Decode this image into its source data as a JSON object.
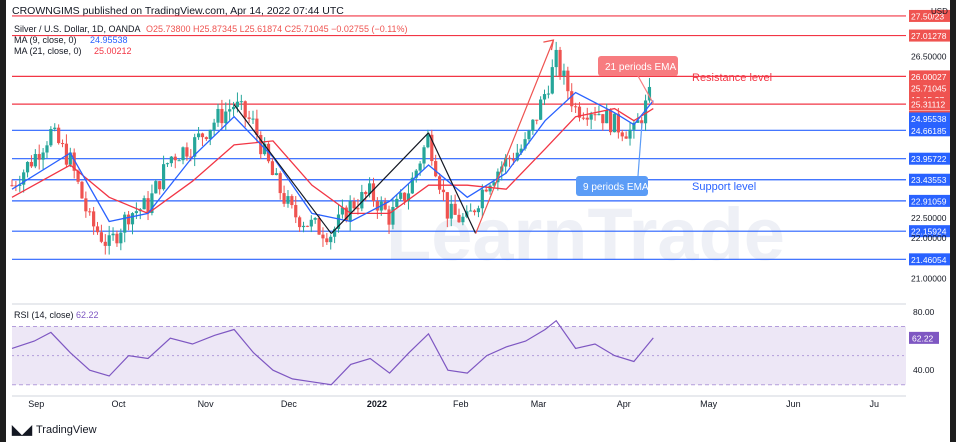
{
  "header": {
    "publisher": "CROWNGIMS published on TradingView.com, Apr 14, 2022 07:44 UTC"
  },
  "legend": {
    "symbol_line": "Silver / U.S. Dollar, 1D, OANDA",
    "ohlc": "O25.73800  H25.87345  L25.61874  C25.71045  −0.02755 (−0.11%)",
    "ma9": "MA (9, close, 0)",
    "ma9_value": "24.95538",
    "ma21": "MA (21, close, 0)",
    "ma21_value": "25.00212",
    "rsi": "RSI (14, close)",
    "rsi_value": "62.22"
  },
  "annotations": {
    "ema21": "21 periods EMA",
    "ema9": "9 periods EMA",
    "resistance": "Resistance level",
    "support": "Support level"
  },
  "footer": {
    "brand": "TradingView"
  },
  "colors": {
    "bull": "#26a69a",
    "bear": "#ef5350",
    "ma9": "#2962ff",
    "ma21": "#f23645",
    "resistance_line": "#f23645",
    "support_line": "#2962ff",
    "rsi": "#7e57c2",
    "ema21_label_bg": "#f77c80",
    "ema9_label_bg": "#5b9cf6",
    "current_price": "#e53935"
  },
  "chart_data": [
    {
      "type": "candlestick",
      "price_ylim": [
        20.6,
        27.3
      ],
      "y_ticks": [
        21.0,
        22.0,
        22.5,
        26.5
      ],
      "x_ticks": [
        "Sep",
        "Oct",
        "Nov",
        "Dec",
        "2022",
        "Feb",
        "Mar",
        "Apr",
        "May",
        "Jun",
        "Ju"
      ],
      "price_labels": [
        {
          "value": 27.5,
          "text": "27.50/23"
        },
        {
          "value": 27.01278,
          "text": "27.01278"
        },
        {
          "value": 26.5,
          "text": "26.50000"
        },
        {
          "value": 26.00027,
          "text": "26.00027"
        },
        {
          "value": 25.71045,
          "text": "25.71045"
        },
        {
          "value": 25.43,
          "text": "13:15:37"
        },
        {
          "value": 25.31112,
          "text": "25.31112"
        },
        {
          "value": 25.00212,
          "text": "25.00212"
        },
        {
          "value": 24.95538,
          "text": "24.95538"
        },
        {
          "value": 24.66185,
          "text": "24.66185"
        },
        {
          "value": 23.95722,
          "text": "23.95722"
        },
        {
          "value": 23.43553,
          "text": "23.43553"
        },
        {
          "value": 22.91059,
          "text": "22.91059"
        },
        {
          "value": 22.5,
          "text": "22.50000"
        },
        {
          "value": 22.15924,
          "text": "22.15924"
        },
        {
          "value": 22.0,
          "text": "22.00000"
        },
        {
          "value": 21.46054,
          "text": "21.46054"
        },
        {
          "value": 21.0,
          "text": "21.00000"
        }
      ],
      "resistance_levels": [
        27.5,
        27.01278,
        26.00027,
        25.31112
      ],
      "support_levels": [
        24.66185,
        23.95722,
        23.43553,
        22.91059,
        22.15924,
        21.46054
      ],
      "close_path": [
        [
          "Aug 24",
          23.3
        ],
        [
          "Sep 1",
          24.0
        ],
        [
          "Sep 7",
          24.6
        ],
        [
          "Sep 14",
          23.9
        ],
        [
          "Sep 21",
          22.4
        ],
        [
          "Sep 28",
          21.8
        ],
        [
          "Oct 5",
          22.6
        ],
        [
          "Oct 12",
          22.8
        ],
        [
          "Oct 20",
          24.0
        ],
        [
          "Oct 28",
          24.3
        ],
        [
          "Nov 5",
          24.9
        ],
        [
          "Nov 12",
          25.3
        ],
        [
          "Nov 19",
          24.8
        ],
        [
          "Nov 26",
          23.5
        ],
        [
          "Dec 3",
          22.6
        ],
        [
          "Dec 10",
          22.3
        ],
        [
          "Dec 17",
          22.1
        ],
        [
          "Dec 24",
          22.8
        ],
        [
          "Dec 31",
          23.1
        ],
        [
          "Jan 7",
          22.5
        ],
        [
          "Jan 14",
          23.2
        ],
        [
          "Jan 21",
          24.5
        ],
        [
          "Jan 28",
          22.6
        ],
        [
          "Feb 4",
          22.4
        ],
        [
          "Feb 11",
          23.4
        ],
        [
          "Feb 18",
          23.9
        ],
        [
          "Feb 25",
          24.3
        ],
        [
          "Mar 4",
          25.6
        ],
        [
          "Mar 8",
          26.4
        ],
        [
          "Mar 15",
          25.2
        ],
        [
          "Mar 22",
          25.2
        ],
        [
          "Mar 29",
          24.8
        ],
        [
          "Apr 5",
          24.6
        ],
        [
          "Apr 12",
          25.7
        ]
      ],
      "ma9_path": [
        [
          "Aug 24",
          23.2
        ],
        [
          "Sep 14",
          24.1
        ],
        [
          "Sep 28",
          22.4
        ],
        [
          "Oct 12",
          22.6
        ],
        [
          "Oct 28",
          24.0
        ],
        [
          "Nov 12",
          25.0
        ],
        [
          "Nov 26",
          24.0
        ],
        [
          "Dec 10",
          22.6
        ],
        [
          "Dec 24",
          22.4
        ],
        [
          "Jan 7",
          22.9
        ],
        [
          "Jan 21",
          23.8
        ],
        [
          "Feb 4",
          23.0
        ],
        [
          "Feb 18",
          23.6
        ],
        [
          "Mar 4",
          24.9
        ],
        [
          "Mar 15",
          25.6
        ],
        [
          "Mar 29",
          25.1
        ],
        [
          "Apr 5",
          24.8
        ],
        [
          "Apr 12",
          25.4
        ]
      ],
      "ma21_path": [
        [
          "Aug 24",
          23.0
        ],
        [
          "Sep 14",
          23.8
        ],
        [
          "Sep 28",
          23.0
        ],
        [
          "Oct 12",
          22.6
        ],
        [
          "Oct 28",
          23.4
        ],
        [
          "Nov 12",
          24.3
        ],
        [
          "Nov 26",
          24.4
        ],
        [
          "Dec 10",
          23.3
        ],
        [
          "Dec 24",
          22.6
        ],
        [
          "Jan 7",
          22.6
        ],
        [
          "Jan 21",
          23.3
        ],
        [
          "Feb 4",
          23.3
        ],
        [
          "Feb 18",
          23.2
        ],
        [
          "Mar 4",
          24.2
        ],
        [
          "Mar 15",
          25.0
        ],
        [
          "Mar 29",
          25.2
        ],
        [
          "Apr 5",
          24.9
        ],
        [
          "Apr 12",
          25.2
        ]
      ],
      "drawn_trendlines": [
        [
          [
            "Nov 12",
            25.3
          ],
          [
            "Dec 17",
            22.1
          ]
        ],
        [
          [
            "Dec 17",
            22.1
          ],
          [
            "Jan 21",
            24.6
          ]
        ],
        [
          [
            "Jan 21",
            24.6
          ],
          [
            "Feb 7",
            22.1
          ]
        ],
        [
          [
            "Feb 7",
            22.1
          ],
          [
            "Mar 7",
            26.9
          ]
        ]
      ]
    },
    {
      "type": "line",
      "title": "RSI (14, close)",
      "ylim": [
        25,
        80
      ],
      "y_ticks": [
        40.0,
        80.0
      ],
      "band": [
        30,
        70
      ],
      "last_value": 62.22,
      "values_path": [
        [
          "Aug 24",
          55
        ],
        [
          "Sep 1",
          60
        ],
        [
          "Sep 7",
          66
        ],
        [
          "Sep 14",
          52
        ],
        [
          "Sep 21",
          40
        ],
        [
          "Sep 28",
          36
        ],
        [
          "Oct 5",
          50
        ],
        [
          "Oct 12",
          48
        ],
        [
          "Oct 20",
          62
        ],
        [
          "Oct 28",
          58
        ],
        [
          "Nov 5",
          64
        ],
        [
          "Nov 12",
          68
        ],
        [
          "Nov 19",
          52
        ],
        [
          "Nov 26",
          40
        ],
        [
          "Dec 3",
          34
        ],
        [
          "Dec 10",
          32
        ],
        [
          "Dec 17",
          30
        ],
        [
          "Dec 24",
          44
        ],
        [
          "Dec 31",
          48
        ],
        [
          "Jan 7",
          38
        ],
        [
          "Jan 14",
          52
        ],
        [
          "Jan 21",
          65
        ],
        [
          "Jan 28",
          40
        ],
        [
          "Feb 4",
          38
        ],
        [
          "Feb 11",
          50
        ],
        [
          "Feb 18",
          56
        ],
        [
          "Feb 25",
          60
        ],
        [
          "Mar 4",
          68
        ],
        [
          "Mar 8",
          74
        ],
        [
          "Mar 15",
          55
        ],
        [
          "Mar 22",
          58
        ],
        [
          "Mar 29",
          50
        ],
        [
          "Apr 5",
          46
        ],
        [
          "Apr 12",
          62.22
        ]
      ]
    }
  ]
}
